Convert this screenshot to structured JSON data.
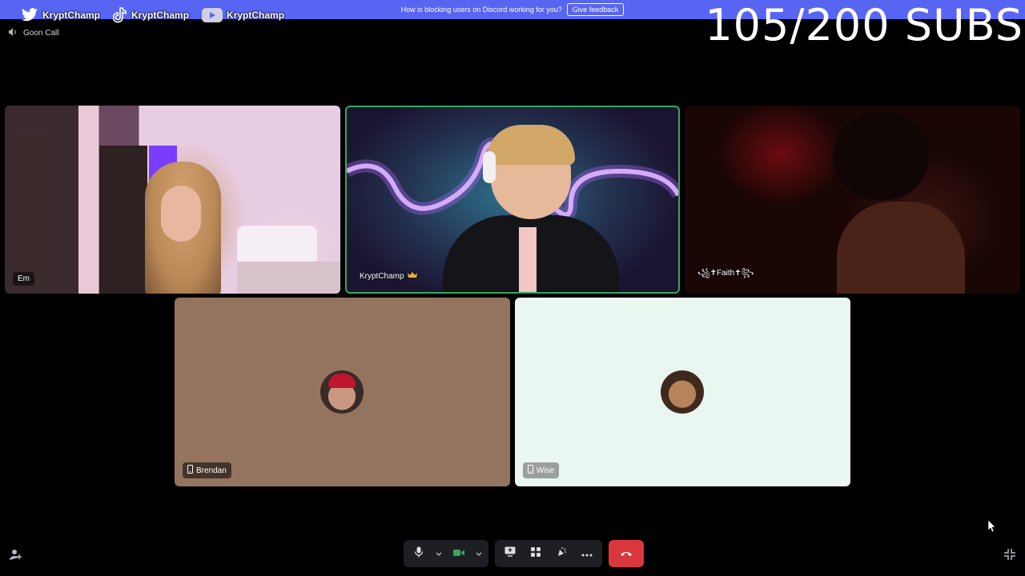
{
  "banner": {
    "message": "How is blocking users on Discord working for you?",
    "button_label": "Give feedback"
  },
  "overlay": {
    "socials": [
      {
        "platform": "twitter",
        "icon": "twitter-icon",
        "handle": "KryptChamp"
      },
      {
        "platform": "tiktok",
        "icon": "tiktok-icon",
        "handle": "KryptChamp"
      },
      {
        "platform": "youtube",
        "icon": "youtube-icon",
        "handle": "KryptChamp"
      }
    ],
    "sub_counter": "105/200 SUBS"
  },
  "call": {
    "title": "Goon Call",
    "icon": "speaker-icon"
  },
  "participants": [
    {
      "name": "Em",
      "video": true,
      "speaking": false
    },
    {
      "name": "KryptChamp",
      "video": true,
      "speaking": true,
      "badge": "crown-icon"
    },
    {
      "name": "꧁✝Faith✝꧂",
      "video": true,
      "speaking": false
    },
    {
      "name": "Brendan",
      "video": false,
      "device": "mobile-icon",
      "tile_color": "#95745f"
    },
    {
      "name": "Wise",
      "video": false,
      "device": "mobile-icon",
      "tile_color": "#eaf6f0"
    }
  ],
  "controls": {
    "mic": "microphone-icon",
    "camera": "camera-icon",
    "screen_share": "screen-share-icon",
    "activities": "activities-icon",
    "soundboard": "soundboard-icon",
    "more": "more-icon",
    "disconnect": "phone-hangup-icon"
  },
  "colors": {
    "banner": "#5865f2",
    "speaking_border": "#3ba55d",
    "disconnect": "#da373c"
  }
}
